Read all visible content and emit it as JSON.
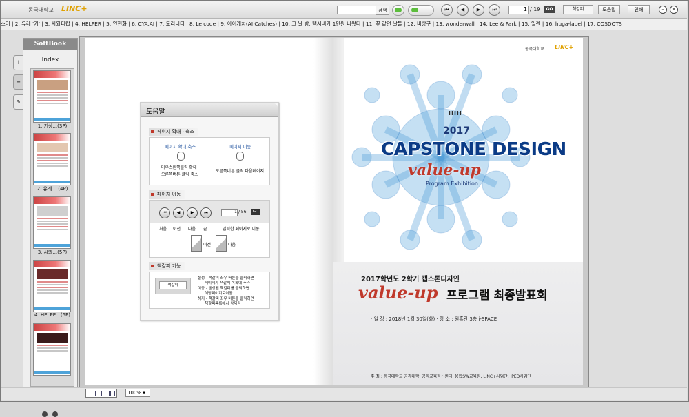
{
  "toolbar": {
    "brand_text": "동국대학교",
    "brand_linc": "LINC+",
    "search_placeholder": "",
    "search_label": "검색",
    "nav_first": "⏮",
    "nav_prev": "◀",
    "nav_next": "▶",
    "nav_last": "⏭",
    "page_current": "1",
    "page_total": "/ 19",
    "go_label": "GO",
    "bookmark_label": "책갈피",
    "help_label": "도움말",
    "print_label": "인쇄"
  },
  "chapters": "스터 | 2. 유레 '카' | 3. 사와디캅 | 4. HELPER | 5. 인현화 | 6. CYA.AI | 7. 도리니티 | 8. Le code | 9. 아이캐치(AI Catches) | 10. 그 날 밤, 택시비가 1만원 나왔다 | 11. 꽃 같던 날들 | 12. 비상구 | 13. wonderwall | 14. Lee & Park | 15. 일렌 | 16. huga-label | 17. COSDOTS",
  "index": {
    "logo": "SoftBook",
    "title": "Index",
    "thumbs": [
      {
        "label": "1. 기상...(3P)"
      },
      {
        "label": "2. 유레 ...(4P)"
      },
      {
        "label": "3. 사와...(5P)"
      },
      {
        "label": "4. HELPE...(6P)"
      }
    ]
  },
  "help": {
    "title": "도움말",
    "zoom_section": "페이지 확대 · 축소",
    "zoom_col_title": "페이지 확대,축소",
    "zoom_line1": "마우스왼쪽클릭 확대",
    "zoom_line2": "오른쪽버튼 클릭 축소",
    "move_col_title": "페이지 이동",
    "move_line": "오른쪽버튼 클릭 다음페이지",
    "nav_section": "페이지 이동",
    "nav_first_label": "처음",
    "nav_prev_label": "이전",
    "nav_next_label": "다음",
    "nav_last_label": "끝",
    "nav_input_value": "1",
    "nav_total": "/ 56",
    "nav_go": "GO",
    "nav_input_desc": "입력한 페이지로 이동",
    "fold_prev": "이전",
    "fold_next": "다음",
    "bm_section": "책갈피 기능",
    "bm_widget": "책갈피",
    "bm_line1": "설정 - 책갈피 좌우 버튼을 클릭하면",
    "bm_line1b": "페이지가 책갈피 목록에 추가",
    "bm_line2": "이동 - 생성된 책갈피를 클릭하면",
    "bm_line2b": "해당페이지로이동",
    "bm_line3": "해지 - 책갈피 좌우 버튼을 클릭하면",
    "bm_line3b": "책갈피목록에서 삭제됨"
  },
  "cover": {
    "logo_text": "동국대학교",
    "logo_linc": "LINC+",
    "roman": "IIIII",
    "year": "2017",
    "capstone": "CAPSTONE DESIGN",
    "value_up": "value-up",
    "program": "Program Exhibition",
    "subtitle": "2017학년도 2학기 캡스톤디자인",
    "value_up2": "value-up",
    "main_title": "프로그램 최종발표회",
    "info": "· 일 정 : 2018년 1월 30일(화)    · 장 소 : 원흥관 3층 i-SPACE",
    "host": "주 최 : 동국대학교 공과대학, 공학교육혁신센터, 융합SW교육원, LINC+사업단, IPED사업단"
  },
  "status": {
    "zoom": "100%"
  },
  "colors": {
    "accent_red": "#c0392b",
    "cover_blue": "#0b3b86",
    "linc_orange": "#e0a100"
  }
}
